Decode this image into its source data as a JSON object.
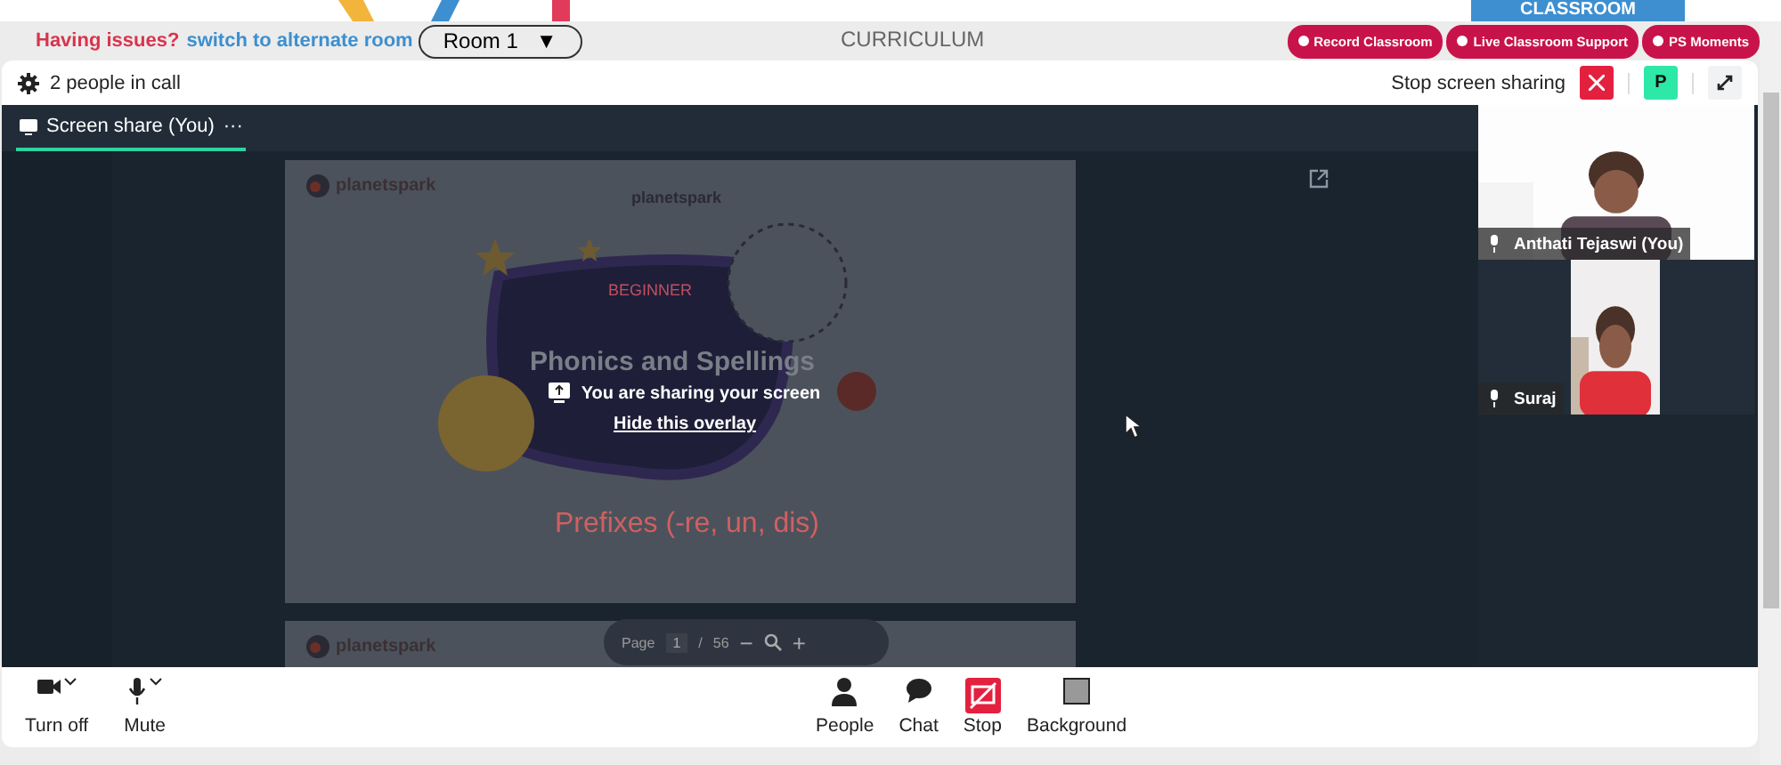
{
  "top_banner": {
    "label": "CLASSROOM"
  },
  "header": {
    "issue_text": "Having issues?",
    "alt_room_link": "switch to alternate room",
    "room_select": "Room 1",
    "caret": "▼",
    "title": "CURRICULUM",
    "actions": [
      "Record Classroom",
      "Live Classroom Support",
      "PS Moments"
    ]
  },
  "call_bar": {
    "people_count": "2 people in call",
    "stop_label": "Stop screen sharing",
    "avatar": "P"
  },
  "tabs": [
    {
      "label": "Screen share (You)",
      "selected": true,
      "menu": "···"
    }
  ],
  "slides": [
    {
      "logo": "planetspark",
      "center_logo": "planetspark",
      "badge": "BEGINNER",
      "title": "Phonics and Spellings",
      "subtitle": "Prefixes (-re, un, dis)"
    },
    {
      "logo": "planetspark"
    }
  ],
  "overlay": {
    "message": "You are sharing your screen",
    "link": "Hide this overlay"
  },
  "pager": {
    "label": "Page",
    "page": "1",
    "separator": "/",
    "total": "56",
    "zoom_out": "−",
    "zoom_in": "+"
  },
  "participants": [
    {
      "name": "Anthati Tejaswi (You)",
      "kind": "light"
    },
    {
      "name": "Suraj",
      "kind": "dark"
    }
  ],
  "toolbar": {
    "left": [
      {
        "label": "Turn off",
        "kind": "camera"
      },
      {
        "label": "Mute",
        "kind": "mic"
      }
    ],
    "center": [
      {
        "label": "People",
        "kind": "people"
      },
      {
        "label": "Chat",
        "kind": "chat"
      },
      {
        "label": "Stop",
        "kind": "stop"
      },
      {
        "label": "Background",
        "kind": "background"
      }
    ]
  }
}
